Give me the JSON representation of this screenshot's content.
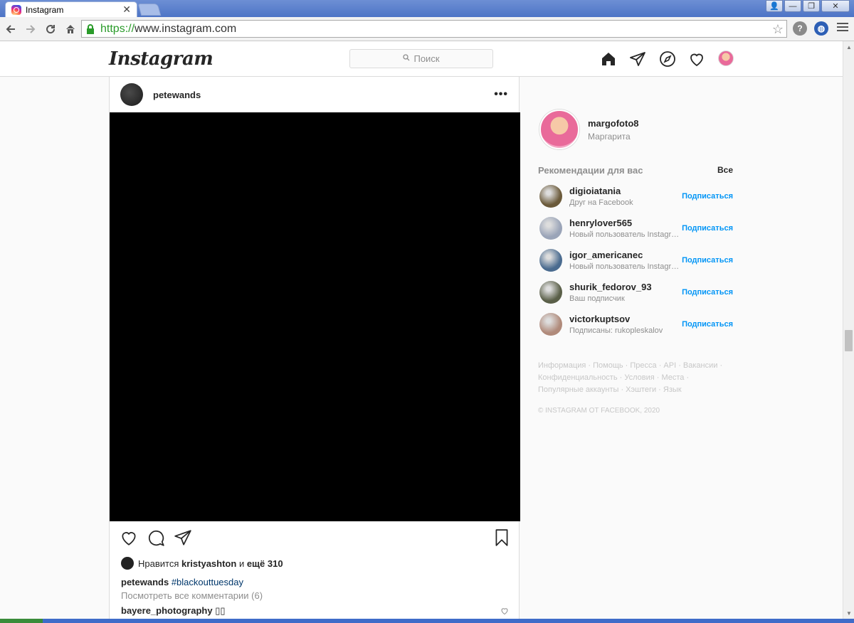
{
  "browser": {
    "tab_title": "Instagram",
    "tab_close": "✕",
    "url_scheme": "https://",
    "url_rest": "www.instagram.com",
    "win_buttons": [
      "👤",
      "—",
      "❐",
      "✕"
    ]
  },
  "header": {
    "logo": "Instagram",
    "search_placeholder": "Поиск"
  },
  "post": {
    "username": "petewands",
    "more": "•••",
    "likes_prefix": "Нравится",
    "likes_user": "kristyashton",
    "likes_and": "и",
    "likes_more": "ещё 310",
    "caption_user": "petewands",
    "caption_hashtag": "#blackouttuesday",
    "view_all": "Посмотреть все комментарии (6)",
    "comment_user": "bayere_photography",
    "comment_text": "▯▯"
  },
  "sidebar": {
    "me_username": "margofoto8",
    "me_name": "Маргарита",
    "rec_title": "Рекомендации для вас",
    "rec_all": "Все",
    "follow_label": "Подписаться",
    "recommendations": [
      {
        "username": "digioiatania",
        "sub": "Друг на Facebook",
        "color": "#6b5a3a"
      },
      {
        "username": "henrylover565",
        "sub": "Новый пользователь Instagram",
        "color": "#9aa4b8"
      },
      {
        "username": "igor_americanec",
        "sub": "Новый пользователь Instagram",
        "color": "#4a6b8f"
      },
      {
        "username": "shurik_fedorov_93",
        "sub": "Ваш подписчик",
        "color": "#5a5f48"
      },
      {
        "username": "victorkuptsov",
        "sub": "Подписаны: rukopleskalov",
        "color": "#b08a7a"
      }
    ],
    "footer_links": "Информация · Помощь · Пресса · API · Вакансии · Конфиденциальность · Условия · Места · Популярные аккаунты · Хэштеги · Язык",
    "copyright": "© Instagram от Facebook, 2020"
  }
}
